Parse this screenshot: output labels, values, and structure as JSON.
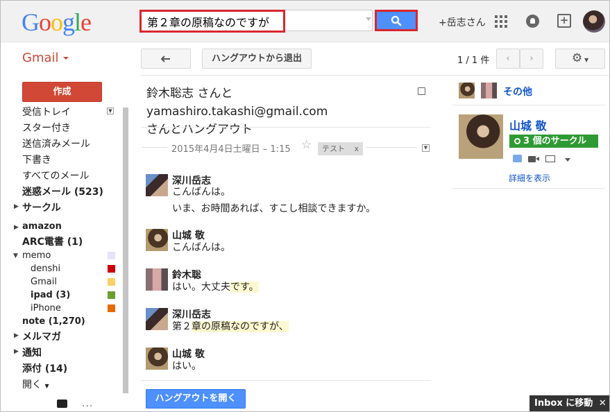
{
  "topbar": {
    "search_value": "第２章の原稿なのですが",
    "user_link": "+岳志さん"
  },
  "logo": [
    "G",
    "o",
    "o",
    "g",
    "l",
    "e"
  ],
  "logo_colors": [
    "#4285f4",
    "#ea4335",
    "#fbbc05",
    "#4285f4",
    "#34a853",
    "#ea4335"
  ],
  "app": {
    "name": "Gmail",
    "compose": "作成"
  },
  "sidebar": {
    "items": [
      {
        "label": "受信トレイ",
        "bold": false
      },
      {
        "label": "スター付き",
        "bold": false
      },
      {
        "label": "送信済みメール",
        "bold": false
      },
      {
        "label": "下書き",
        "bold": false
      },
      {
        "label": "すべてのメール",
        "bold": false
      },
      {
        "label": "迷惑メール (523)",
        "bold": true
      },
      {
        "label": "サークル",
        "bold": true
      },
      {
        "label": "amazon",
        "bold": true
      },
      {
        "label": "ARC電書 (1)",
        "bold": true
      },
      {
        "label": "memo",
        "bold": false
      },
      {
        "label": "denshi",
        "bold": false
      },
      {
        "label": "Gmail",
        "bold": false
      },
      {
        "label": "ipad (3)",
        "bold": true
      },
      {
        "label": "iPhone",
        "bold": false
      },
      {
        "label": "note (1,270)",
        "bold": true
      },
      {
        "label": "メルマガ",
        "bold": true
      },
      {
        "label": "通知",
        "bold": true
      },
      {
        "label": "添付 (14)",
        "bold": true
      },
      {
        "label": "開く",
        "bold": false
      }
    ],
    "label_colors": {
      "memo": "#e3e3fb",
      "denshi": "#cc0000",
      "gmail": "#fad165",
      "ipad": "#6d9e30",
      "iphone": "#e66b00"
    }
  },
  "toolbar": {
    "leave_hangout": "ハングアウトから退出",
    "pager": "1 / 1 件"
  },
  "conversation": {
    "title_part1": "鈴木聡志 さんと",
    "title_email": "yamashiro.takashi@gmail.com",
    "title_part2": "さんとハングアウト",
    "date": "2015年4月4日土曜日",
    "time": "– 1:15",
    "label": "テスト",
    "label_close": "x",
    "messages": [
      {
        "sender": "深川岳志",
        "lines": [
          "こんばんは。",
          "いま、お時間あれば、すこし相談できますか。"
        ]
      },
      {
        "sender": "山城 敬",
        "lines": [
          "こんばんは。"
        ]
      },
      {
        "sender": "鈴木聡",
        "lines": [
          "はい。大丈夫です。"
        ],
        "highlight": "です。"
      },
      {
        "sender": "深川岳志",
        "lines": [
          "第２章の原稿なのですが、"
        ],
        "highlight": "章の原稿なのですが、"
      },
      {
        "sender": "山城 敬",
        "lines": [
          "はい。"
        ]
      }
    ],
    "open_hangout": "ハングアウトを開く"
  },
  "right_panel": {
    "others": "その他",
    "contact_name": "山城 敬",
    "circles": "3 個のサークル",
    "details": "詳細を表示"
  },
  "footer": {
    "inbox_move": "Inbox に移動",
    "close": "✕",
    "more": "..."
  }
}
